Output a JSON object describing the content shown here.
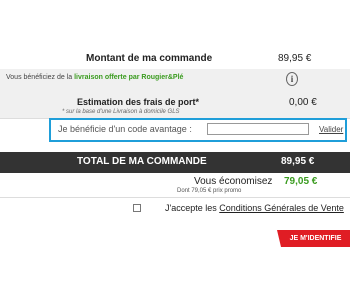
{
  "summary": {
    "montant_label": "Montant de ma commande",
    "montant_value": "89,95 €",
    "livraison_prefix": "Vous bénéficiez de la ",
    "livraison_highlight": "livraison offerte par Rougier&Plé",
    "info_icon_glyph": "i",
    "estimation_label": "Estimation des frais de port*",
    "estimation_sub": "* sur la base d'une Livraison à domicile GLS",
    "estimation_value": "0,00 €"
  },
  "promo": {
    "label": "Je bénéficie d'un code avantage :",
    "input_value": "",
    "input_placeholder": "",
    "submit_label": "Valider"
  },
  "total": {
    "label": "TOTAL DE MA COMMANDE",
    "value": "89,95 €"
  },
  "savings": {
    "label": "Vous économisez",
    "sub": "Dont 79,05 € prix promo",
    "value": "79,05 €"
  },
  "terms": {
    "prefix": "J'accepte les ",
    "link": "Conditions Générales de Vente",
    "checked": false
  },
  "cta": {
    "label": "JE M'IDENTIFIE"
  },
  "colors": {
    "accent_blue": "#1f9ed9",
    "green": "#3a9b1f",
    "cta_red": "#e01d24",
    "total_bar": "#333333"
  }
}
